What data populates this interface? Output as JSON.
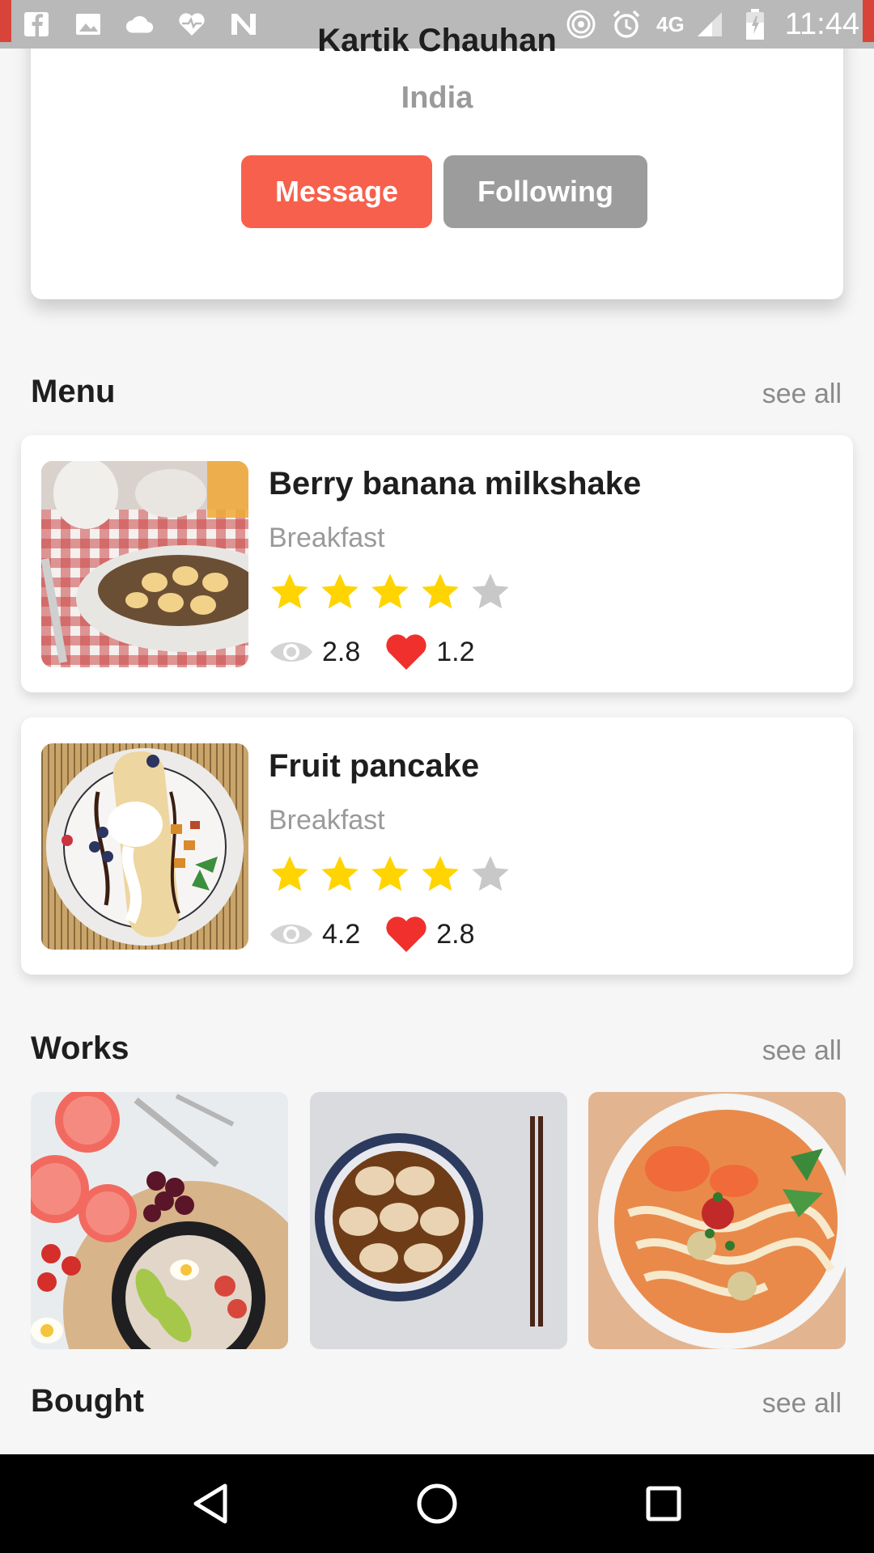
{
  "status_bar": {
    "time": "11:44",
    "network": "4G",
    "left_icons": [
      "facebook-icon",
      "image-icon",
      "cloud-icon",
      "heart-rate-icon",
      "n-icon"
    ],
    "right_icons": [
      "hotspot-icon",
      "alarm-icon",
      "signal-icon",
      "battery-icon"
    ]
  },
  "profile": {
    "name": "Kartik Chauhan",
    "country": "India",
    "message_label": "Message",
    "following_label": "Following"
  },
  "colors": {
    "accent": "#f7604c",
    "muted_button": "#9c9c9c",
    "star_filled": "#ffd400",
    "star_empty": "#c8c8c8",
    "heart": "#f0302c"
  },
  "menu": {
    "title": "Menu",
    "see_all": "see all",
    "items": [
      {
        "title": "Berry banana milkshake",
        "category": "Breakfast",
        "rating": 4,
        "rating_max": 5,
        "views": "2.8",
        "likes": "1.2"
      },
      {
        "title": "Fruit pancake",
        "category": "Breakfast",
        "rating": 4,
        "rating_max": 5,
        "views": "4.2",
        "likes": "2.8"
      }
    ]
  },
  "works": {
    "title": "Works",
    "see_all": "see all"
  },
  "bought": {
    "title": "Bought",
    "see_all": "see all"
  },
  "nav": {
    "icons": [
      "back-icon",
      "home-icon",
      "recents-icon"
    ]
  }
}
